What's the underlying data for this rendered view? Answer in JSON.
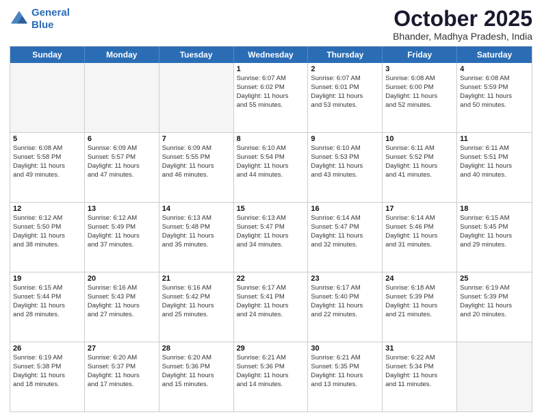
{
  "header": {
    "logo_line1": "General",
    "logo_line2": "Blue",
    "main_title": "October 2025",
    "subtitle": "Bhander, Madhya Pradesh, India"
  },
  "weekdays": [
    "Sunday",
    "Monday",
    "Tuesday",
    "Wednesday",
    "Thursday",
    "Friday",
    "Saturday"
  ],
  "rows": [
    [
      {
        "day": "",
        "empty": true,
        "lines": []
      },
      {
        "day": "",
        "empty": true,
        "lines": []
      },
      {
        "day": "",
        "empty": true,
        "lines": []
      },
      {
        "day": "1",
        "empty": false,
        "lines": [
          "Sunrise: 6:07 AM",
          "Sunset: 6:02 PM",
          "Daylight: 11 hours",
          "and 55 minutes."
        ]
      },
      {
        "day": "2",
        "empty": false,
        "lines": [
          "Sunrise: 6:07 AM",
          "Sunset: 6:01 PM",
          "Daylight: 11 hours",
          "and 53 minutes."
        ]
      },
      {
        "day": "3",
        "empty": false,
        "lines": [
          "Sunrise: 6:08 AM",
          "Sunset: 6:00 PM",
          "Daylight: 11 hours",
          "and 52 minutes."
        ]
      },
      {
        "day": "4",
        "empty": false,
        "lines": [
          "Sunrise: 6:08 AM",
          "Sunset: 5:59 PM",
          "Daylight: 11 hours",
          "and 50 minutes."
        ]
      }
    ],
    [
      {
        "day": "5",
        "empty": false,
        "lines": [
          "Sunrise: 6:08 AM",
          "Sunset: 5:58 PM",
          "Daylight: 11 hours",
          "and 49 minutes."
        ]
      },
      {
        "day": "6",
        "empty": false,
        "lines": [
          "Sunrise: 6:09 AM",
          "Sunset: 5:57 PM",
          "Daylight: 11 hours",
          "and 47 minutes."
        ]
      },
      {
        "day": "7",
        "empty": false,
        "lines": [
          "Sunrise: 6:09 AM",
          "Sunset: 5:55 PM",
          "Daylight: 11 hours",
          "and 46 minutes."
        ]
      },
      {
        "day": "8",
        "empty": false,
        "lines": [
          "Sunrise: 6:10 AM",
          "Sunset: 5:54 PM",
          "Daylight: 11 hours",
          "and 44 minutes."
        ]
      },
      {
        "day": "9",
        "empty": false,
        "lines": [
          "Sunrise: 6:10 AM",
          "Sunset: 5:53 PM",
          "Daylight: 11 hours",
          "and 43 minutes."
        ]
      },
      {
        "day": "10",
        "empty": false,
        "lines": [
          "Sunrise: 6:11 AM",
          "Sunset: 5:52 PM",
          "Daylight: 11 hours",
          "and 41 minutes."
        ]
      },
      {
        "day": "11",
        "empty": false,
        "lines": [
          "Sunrise: 6:11 AM",
          "Sunset: 5:51 PM",
          "Daylight: 11 hours",
          "and 40 minutes."
        ]
      }
    ],
    [
      {
        "day": "12",
        "empty": false,
        "lines": [
          "Sunrise: 6:12 AM",
          "Sunset: 5:50 PM",
          "Daylight: 11 hours",
          "and 38 minutes."
        ]
      },
      {
        "day": "13",
        "empty": false,
        "lines": [
          "Sunrise: 6:12 AM",
          "Sunset: 5:49 PM",
          "Daylight: 11 hours",
          "and 37 minutes."
        ]
      },
      {
        "day": "14",
        "empty": false,
        "lines": [
          "Sunrise: 6:13 AM",
          "Sunset: 5:48 PM",
          "Daylight: 11 hours",
          "and 35 minutes."
        ]
      },
      {
        "day": "15",
        "empty": false,
        "lines": [
          "Sunrise: 6:13 AM",
          "Sunset: 5:47 PM",
          "Daylight: 11 hours",
          "and 34 minutes."
        ]
      },
      {
        "day": "16",
        "empty": false,
        "lines": [
          "Sunrise: 6:14 AM",
          "Sunset: 5:47 PM",
          "Daylight: 11 hours",
          "and 32 minutes."
        ]
      },
      {
        "day": "17",
        "empty": false,
        "lines": [
          "Sunrise: 6:14 AM",
          "Sunset: 5:46 PM",
          "Daylight: 11 hours",
          "and 31 minutes."
        ]
      },
      {
        "day": "18",
        "empty": false,
        "lines": [
          "Sunrise: 6:15 AM",
          "Sunset: 5:45 PM",
          "Daylight: 11 hours",
          "and 29 minutes."
        ]
      }
    ],
    [
      {
        "day": "19",
        "empty": false,
        "lines": [
          "Sunrise: 6:15 AM",
          "Sunset: 5:44 PM",
          "Daylight: 11 hours",
          "and 28 minutes."
        ]
      },
      {
        "day": "20",
        "empty": false,
        "lines": [
          "Sunrise: 6:16 AM",
          "Sunset: 5:43 PM",
          "Daylight: 11 hours",
          "and 27 minutes."
        ]
      },
      {
        "day": "21",
        "empty": false,
        "lines": [
          "Sunrise: 6:16 AM",
          "Sunset: 5:42 PM",
          "Daylight: 11 hours",
          "and 25 minutes."
        ]
      },
      {
        "day": "22",
        "empty": false,
        "lines": [
          "Sunrise: 6:17 AM",
          "Sunset: 5:41 PM",
          "Daylight: 11 hours",
          "and 24 minutes."
        ]
      },
      {
        "day": "23",
        "empty": false,
        "lines": [
          "Sunrise: 6:17 AM",
          "Sunset: 5:40 PM",
          "Daylight: 11 hours",
          "and 22 minutes."
        ]
      },
      {
        "day": "24",
        "empty": false,
        "lines": [
          "Sunrise: 6:18 AM",
          "Sunset: 5:39 PM",
          "Daylight: 11 hours",
          "and 21 minutes."
        ]
      },
      {
        "day": "25",
        "empty": false,
        "lines": [
          "Sunrise: 6:19 AM",
          "Sunset: 5:39 PM",
          "Daylight: 11 hours",
          "and 20 minutes."
        ]
      }
    ],
    [
      {
        "day": "26",
        "empty": false,
        "lines": [
          "Sunrise: 6:19 AM",
          "Sunset: 5:38 PM",
          "Daylight: 11 hours",
          "and 18 minutes."
        ]
      },
      {
        "day": "27",
        "empty": false,
        "lines": [
          "Sunrise: 6:20 AM",
          "Sunset: 5:37 PM",
          "Daylight: 11 hours",
          "and 17 minutes."
        ]
      },
      {
        "day": "28",
        "empty": false,
        "lines": [
          "Sunrise: 6:20 AM",
          "Sunset: 5:36 PM",
          "Daylight: 11 hours",
          "and 15 minutes."
        ]
      },
      {
        "day": "29",
        "empty": false,
        "lines": [
          "Sunrise: 6:21 AM",
          "Sunset: 5:36 PM",
          "Daylight: 11 hours",
          "and 14 minutes."
        ]
      },
      {
        "day": "30",
        "empty": false,
        "lines": [
          "Sunrise: 6:21 AM",
          "Sunset: 5:35 PM",
          "Daylight: 11 hours",
          "and 13 minutes."
        ]
      },
      {
        "day": "31",
        "empty": false,
        "lines": [
          "Sunrise: 6:22 AM",
          "Sunset: 5:34 PM",
          "Daylight: 11 hours",
          "and 11 minutes."
        ]
      },
      {
        "day": "",
        "empty": true,
        "lines": []
      }
    ]
  ]
}
